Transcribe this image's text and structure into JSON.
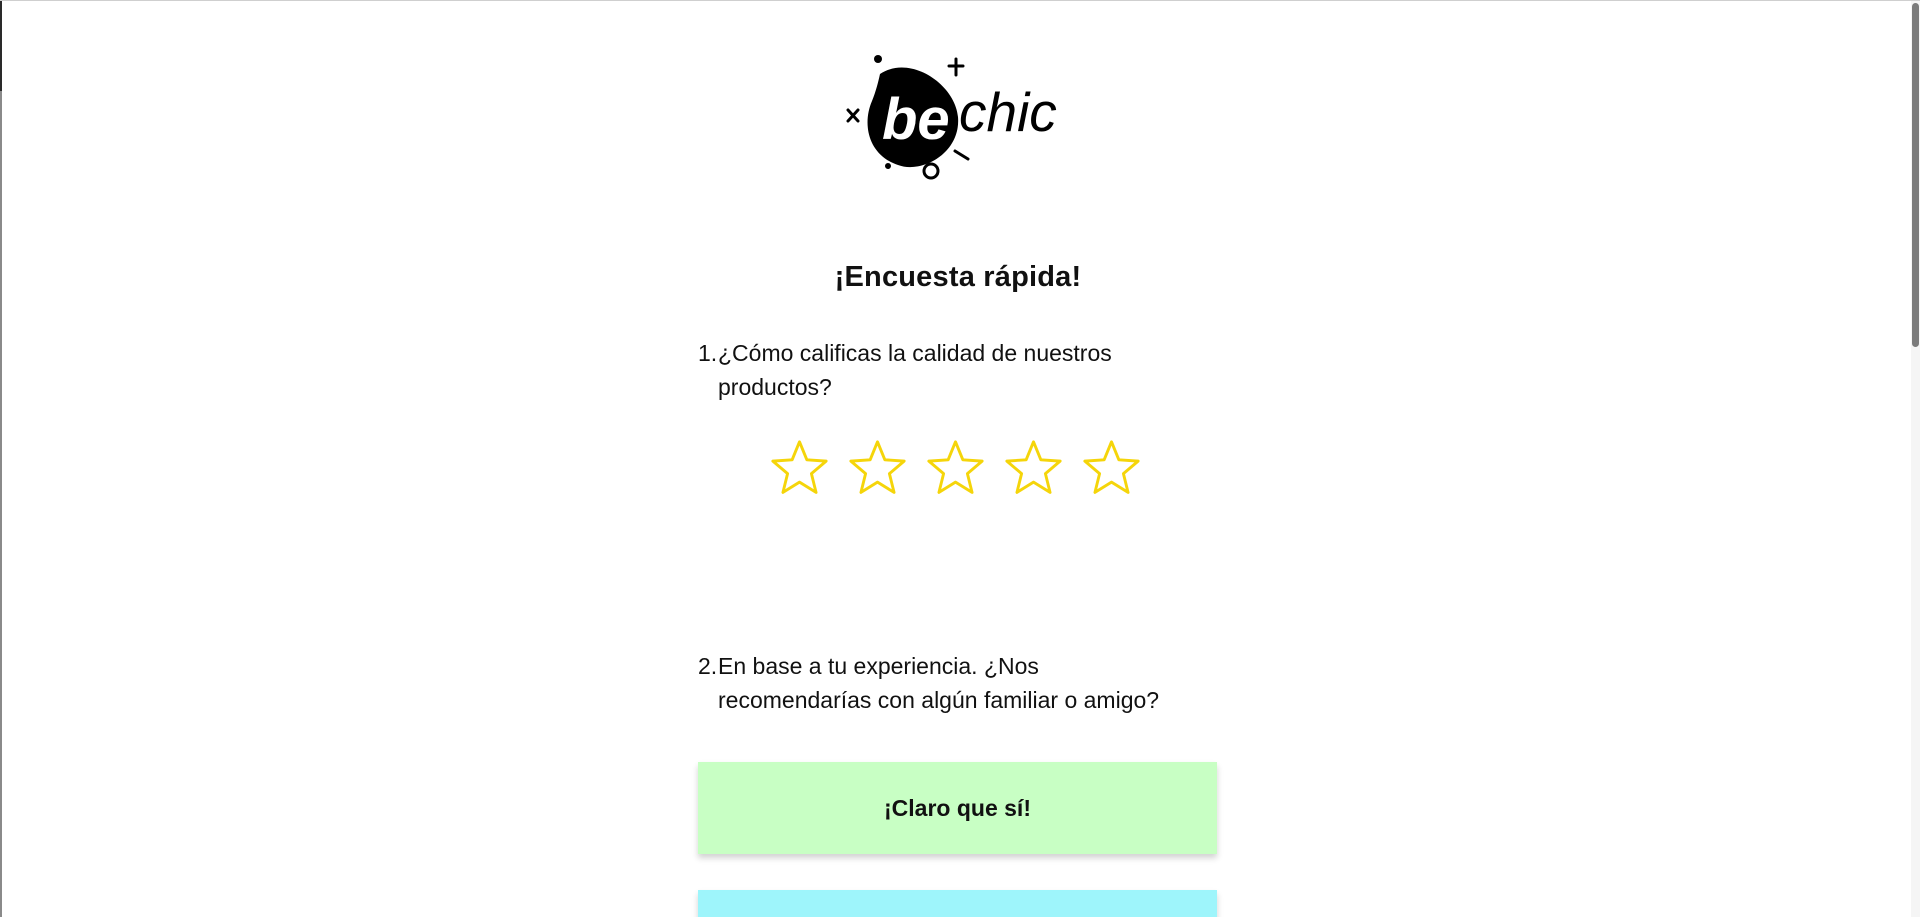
{
  "logo": {
    "text_bold": "be",
    "text_light": "chic"
  },
  "survey": {
    "title": "¡Encuesta rápida!",
    "questions": [
      {
        "number": "1.",
        "text": "¿Cómo calificas la calidad de nuestros productos?"
      },
      {
        "number": "2.",
        "text": "En base a tu experiencia. ¿Nos recomendarías con algún familiar o amigo?"
      }
    ],
    "rating": {
      "max": 5,
      "value": 0,
      "star_color": "#f5d50a",
      "icon": "star-outline-icon"
    },
    "answers": [
      {
        "label": "¡Claro que sí!",
        "color": "#c8ffc4"
      },
      {
        "label": "",
        "color": "#9ef5fb"
      }
    ]
  }
}
